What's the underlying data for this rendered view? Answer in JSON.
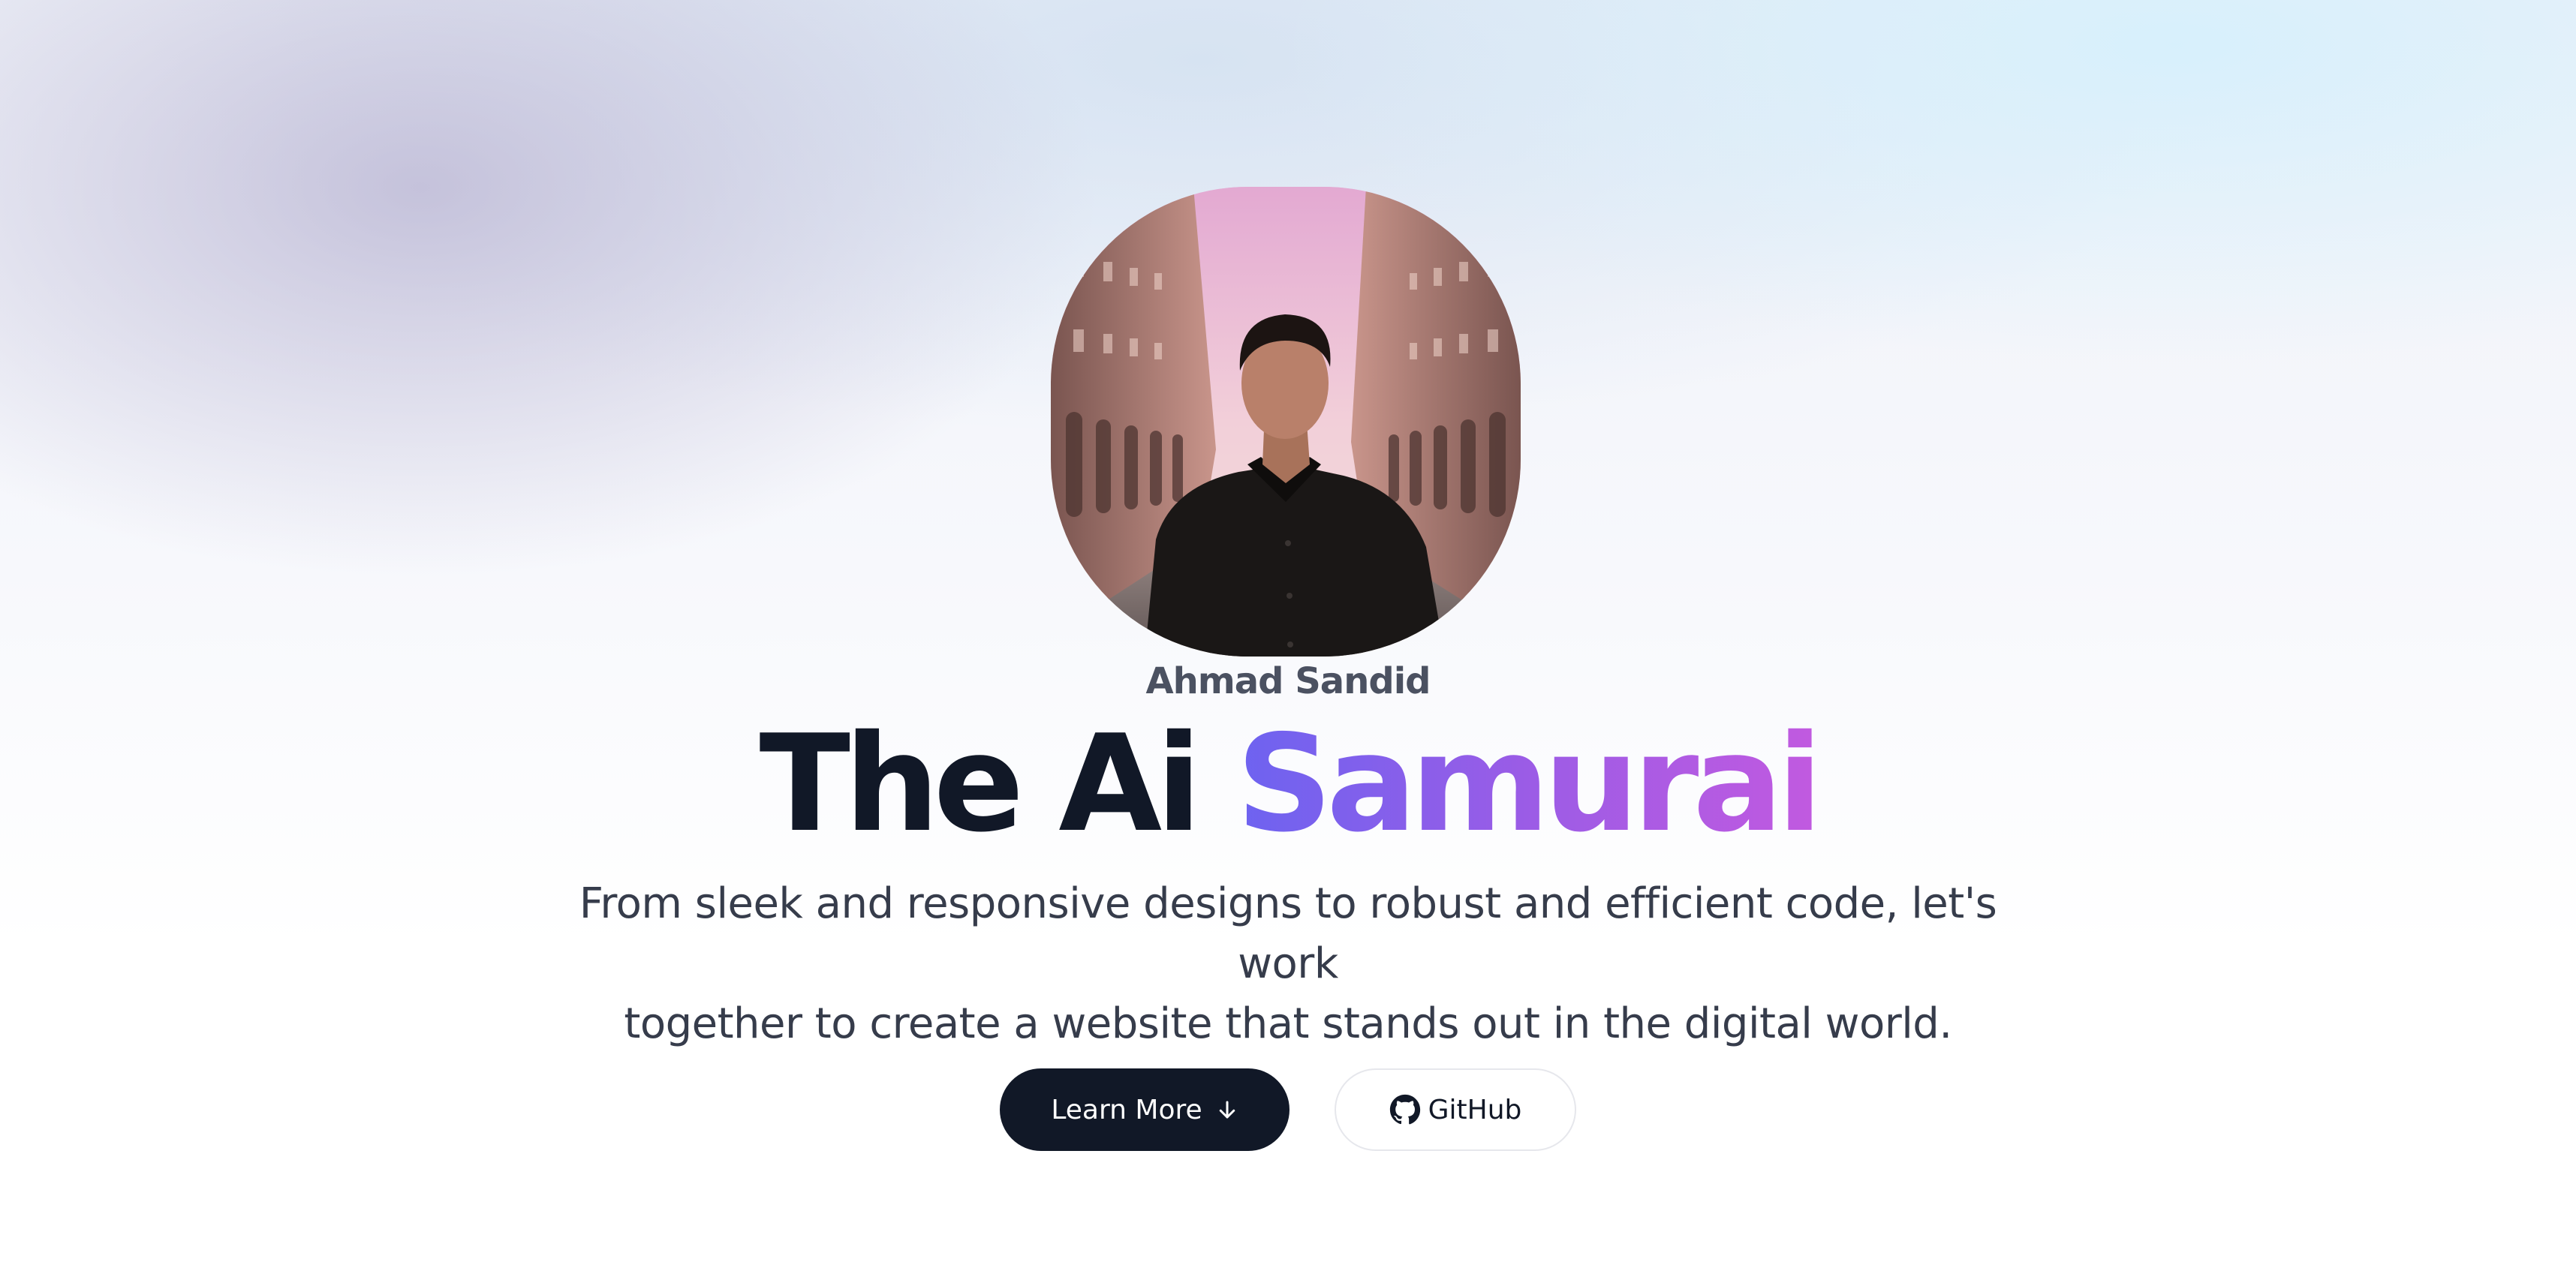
{
  "profile": {
    "name": "Ahmad Sandid",
    "avatar_alt": "Ahmad Sandid portrait"
  },
  "hero": {
    "title_part1": "The Ai ",
    "title_part2": "Samurai",
    "subtitle_line1": "From sleek and responsive designs to robust and efficient code, let's work",
    "subtitle_line2": "together to create a website that stands out in the digital world."
  },
  "actions": {
    "learn_more_label": "Learn More",
    "learn_more_icon": "arrow-down-icon",
    "github_label": "GitHub",
    "github_icon": "github-icon"
  },
  "colors": {
    "dark": "#111827",
    "accent_start": "#6d63f0",
    "accent_end": "#c15ae0",
    "muted_text": "#4b5161"
  }
}
